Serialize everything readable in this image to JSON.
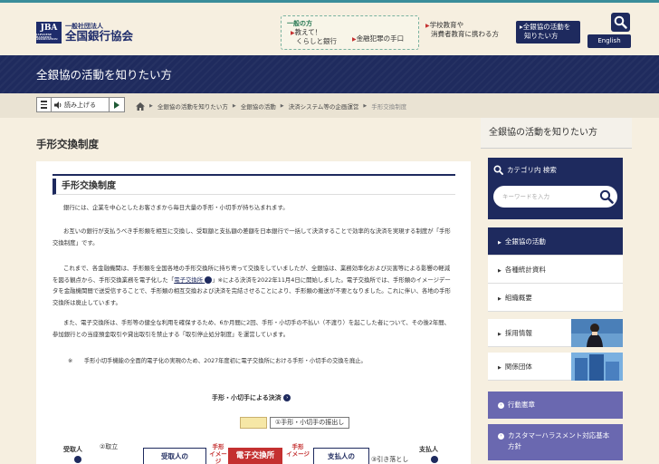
{
  "header": {
    "logo_mark": "JBA",
    "logo_mark_small": "JAPANESE BANKERS ASSOCIATION",
    "logo_sub": "一般社団法人",
    "logo_main": "全国銀行協会",
    "nav_box": {
      "title": "一般の方",
      "item1_line1": "教えて！",
      "item1_line2": "くらしと銀行",
      "item2": "金融犯罪の手口"
    },
    "nav_school_line1": "学校教育や",
    "nav_school_line2": "消費者教育に携わる方",
    "nav_active_line1": "全銀協の活動を",
    "nav_active_line2": "知りたい方",
    "english": "English"
  },
  "banner": {
    "title": "全銀協の活動を知りたい方"
  },
  "toolbar": {
    "read_label": "読み上げる",
    "breadcrumb": [
      "全銀協の活動を知りたい方",
      "全銀協の活動",
      "決済システム等の企画運営",
      "手形交換制度"
    ]
  },
  "main": {
    "page_title": "手形交換制度",
    "section_title": "手形交換制度",
    "p1": "銀行には、企業を中心としたお客さまから毎日大量の手形・小切手が持ち込まれます。",
    "p2": "お互いの銀行が支払うべき手形類を相互に交換し、受取額と支払額の差額を日本銀行で一括して決済することで効率的な決済を実現する制度が「手形交換制度」です。",
    "p3_pre": "これまで、各金融機関は、手形類を全国各地の手形交換所に持ち寄って交換をしていましたが、全銀協は、業務効率化および災害等による影響の軽減を図る観点から、手形交換業務を電子化した「",
    "p3_link": "電子交換所",
    "p3_post": "」※による決済を2022年11月4日に開始しました。電子交換所では、手形類のイメージデータを金融機関間で送受信することで、手形類の相互交換および決済を完結させることにより、手形類の搬送が不要となりました。これに伴い、各地の手形交換所は廃止しています。",
    "p4": "また、電子交換所は、手形等の健全な利用を確保するため、6か月間に2回、手形・小切手の不払い（不渡り）を起こした者について、その後2年間、参加銀行との当座預金取引や貸出取引を禁止する「取引停止処分制度」を運営しています。",
    "note": "※　　手形小切手機能の全面的電子化の実現のため、2027年度初に電子交換所における手形・小切手の交換を廃止。",
    "diagram": {
      "title": "手形・小切手による決済",
      "step1": "①手形・小切手の振出し",
      "step2": "②取立",
      "payee": "受取人",
      "payer": "支払人",
      "payee_bank": "受取人の",
      "center": "電子交換所",
      "payer_bank": "支払人の",
      "img_left_1": "手形",
      "img_left_2": "イメージ",
      "img_right_1": "手形",
      "img_right_2": "イメージ",
      "step3": "③引き落とし"
    }
  },
  "sidebar": {
    "title": "全銀協の活動を知りたい方",
    "search_title": "カテゴリ内 検索",
    "search_placeholder": "キーワードを入力",
    "items": [
      "全銀協の活動",
      "各種統計資料",
      "組織概要",
      "採用情報",
      "関係団体"
    ],
    "purple": [
      "行動憲章",
      "カスタマーハラスメント対応基本",
      "方針"
    ]
  }
}
